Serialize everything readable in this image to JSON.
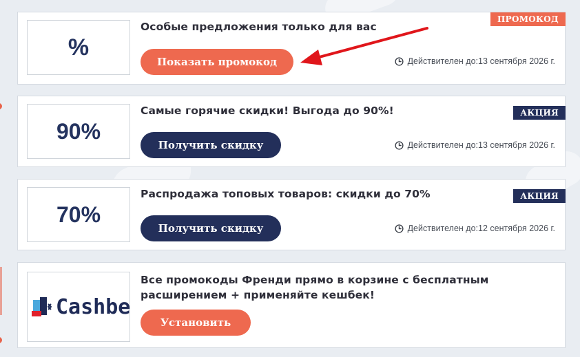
{
  "cards": [
    {
      "thumb": "%",
      "title": "Особые предложения только для вас",
      "badge": "ПРОМОКОД",
      "button": "Показать промокод",
      "validity": "Действителен до:13 сентября 2026 г."
    },
    {
      "thumb": "90%",
      "title": "Самые горячие скидки! Выгода до 90%!",
      "badge": "АКЦИЯ",
      "button": "Получить скидку",
      "validity": "Действителен до:13 сентября 2026 г."
    },
    {
      "thumb": "70%",
      "title": "Распродажа топовых товаров: скидки до 70%",
      "badge": "АКЦИЯ",
      "button": "Получить скидку",
      "validity": "Действителен до:12 сентября 2026 г."
    },
    {
      "logo_text": "Cashbe",
      "title_line1": "Все промокоды Френди прямо в корзине с бесплатным",
      "title_line2": "расширением + применяйте кешбек!",
      "button": "Установить"
    }
  ],
  "colors": {
    "accent_orange": "#ee694f",
    "navy": "#232f5a",
    "arrow_red": "#e0161b"
  },
  "icons": [
    "clock-icon",
    "red-arrow-annotation",
    "cashback-logo-icon"
  ]
}
